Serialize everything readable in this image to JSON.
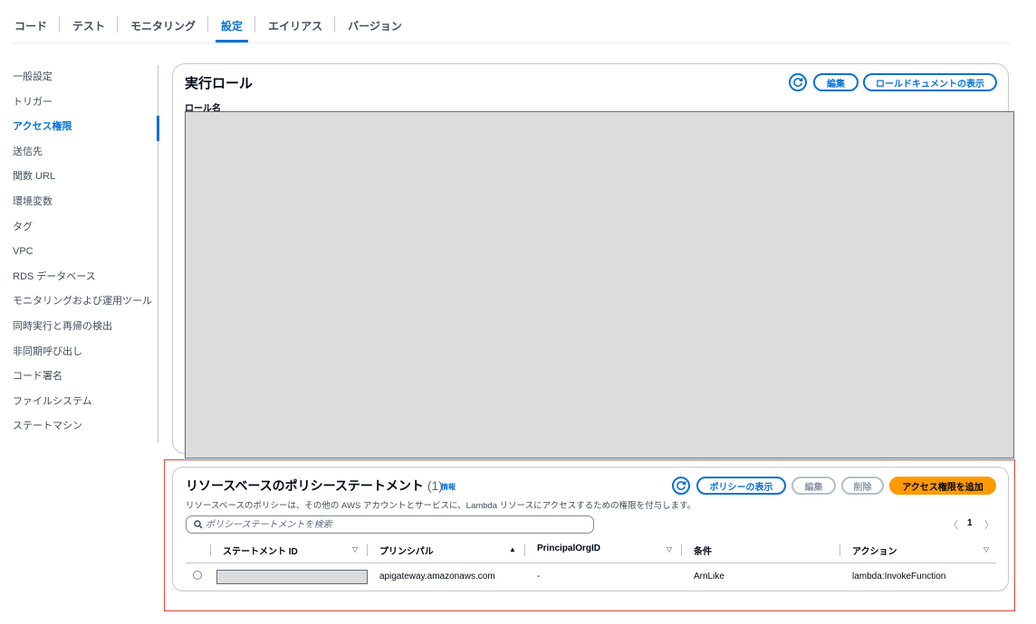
{
  "tabs": [
    "コード",
    "テスト",
    "モニタリング",
    "設定",
    "エイリアス",
    "バージョン"
  ],
  "active_tab": "設定",
  "sidenav": [
    "一般設定",
    "トリガー",
    "アクセス権限",
    "送信先",
    "関数 URL",
    "環境変数",
    "タグ",
    "VPC",
    "RDS データベース",
    "モニタリングおよび運用ツール",
    "同時実行と再帰の検出",
    "非同期呼び出し",
    "コード署名",
    "ファイルシステム",
    "ステートマシン"
  ],
  "active_nav": "アクセス権限",
  "role": {
    "title": "実行ロール",
    "label": "ロール名",
    "edit": "編集",
    "view_doc": "ロールドキュメントの表示"
  },
  "policy": {
    "title": "リソースベースのポリシーステートメント",
    "count": "(1)",
    "info": "情報",
    "description": "リソースベースのポリシーは、その他の AWS アカウントとサービスに、Lambda リソースにアクセスするための権限を付与します。",
    "view_policy": "ポリシーの表示",
    "edit": "編集",
    "delete": "削除",
    "add_permission": "アクセス権限を追加",
    "search_placeholder": "ポリシーステートメントを検索",
    "page": "1",
    "columns": [
      "ステートメント ID",
      "プリンシパル",
      "PrincipalOrgID",
      "条件",
      "アクション"
    ],
    "rows": [
      {
        "statement_id": "",
        "principal": "apigateway.amazonaws.com",
        "principal_org_id": "-",
        "condition": "ArnLike",
        "action": "lambda:InvokeFunction"
      }
    ]
  },
  "icons": {
    "refresh": "refresh-icon",
    "search": "search-icon",
    "sort_asc": "sort-ascending-icon",
    "sort_desc": "sort-descending-icon",
    "prev": "chevron-left-icon",
    "next": "chevron-right-icon"
  },
  "colors": {
    "link": "#0972d3",
    "primary_button": "#ff9900",
    "highlight_border": "#e0443c",
    "redaction": "#dcdcdc"
  }
}
